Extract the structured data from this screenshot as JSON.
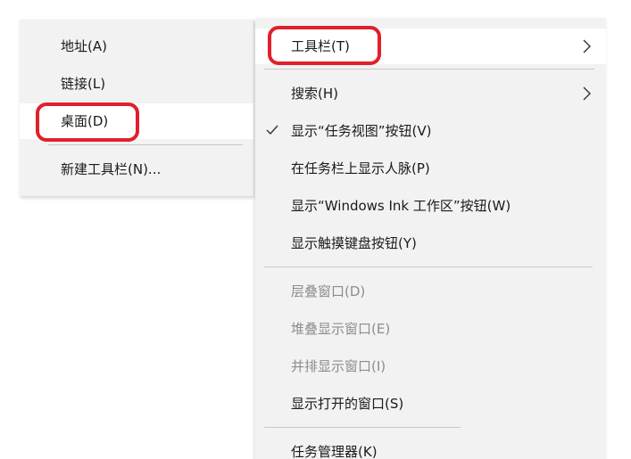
{
  "submenu": {
    "items": [
      {
        "label": "地址(A)"
      },
      {
        "label": "链接(L)"
      },
      {
        "label": "桌面(D)"
      },
      {
        "label": "新建工具栏(N)..."
      }
    ]
  },
  "mainmenu": {
    "items": [
      {
        "label": "工具栏(T)"
      },
      {
        "label": "搜索(H)"
      },
      {
        "label": "显示“任务视图”按钮(V)"
      },
      {
        "label": "在任务栏上显示人脉(P)"
      },
      {
        "label": "显示“Windows Ink 工作区”按钮(W)"
      },
      {
        "label": "显示触摸键盘按钮(Y)"
      },
      {
        "label": "层叠窗口(D)"
      },
      {
        "label": "堆叠显示窗口(E)"
      },
      {
        "label": "并排显示窗口(I)"
      },
      {
        "label": "显示打开的窗口(S)"
      },
      {
        "label": "任务管理器(K)"
      }
    ]
  },
  "icons": {
    "submenu_arrow": "chevron-right-icon",
    "checked_mark": "checkmark-icon"
  },
  "colors": {
    "menu_bg": "#f2f2f2",
    "highlight_bg": "#ffffff",
    "disabled_text": "#8c8c8c",
    "annotation": "#e0202a"
  }
}
